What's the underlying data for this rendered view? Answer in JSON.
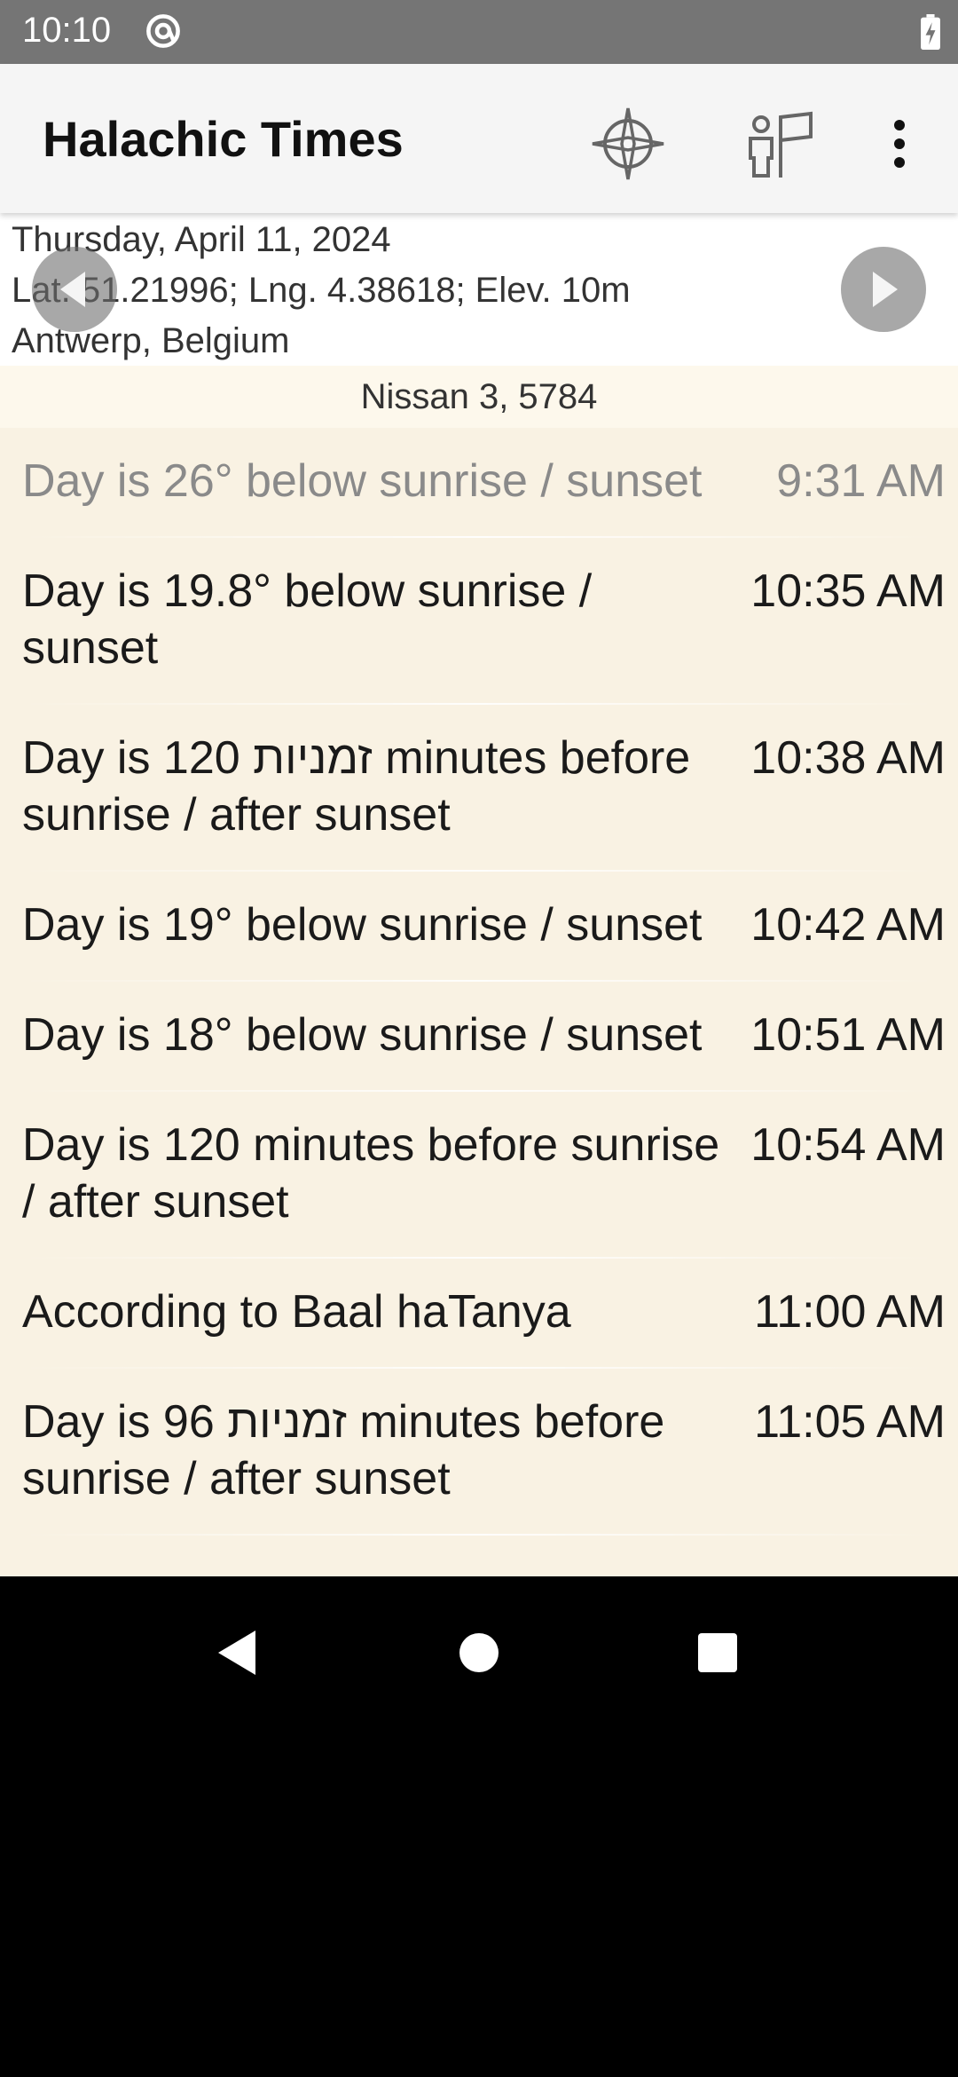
{
  "status": {
    "time": "10:10"
  },
  "appbar": {
    "title": "Halachic Times"
  },
  "header": {
    "date": "Thursday, April 11, 2024",
    "coordinates": "Lat. 51.21996; Lng. 4.38618; Elev. 10m",
    "location": "Antwerp, Belgium",
    "hebrew_date": "Nissan 3, 5784"
  },
  "times": [
    {
      "label": "Day is 26° below sunrise / sunset",
      "time": "9:31 AM"
    },
    {
      "label": "Day is 19.8° below sunrise / sunset",
      "time": "10:35 AM"
    },
    {
      "label": "Day is 120 זמניות minutes before sunrise / after sunset",
      "time": "10:38 AM"
    },
    {
      "label": "Day is 19° below sunrise / sunset",
      "time": "10:42 AM"
    },
    {
      "label": "Day is 18° below sunrise / sunset",
      "time": "10:51 AM"
    },
    {
      "label": "Day is 120 minutes before sunrise / after sunset",
      "time": "10:54 AM"
    },
    {
      "label": "According to Baal haTanya",
      "time": "11:00 AM"
    },
    {
      "label": "Day is 96 זמניות minutes before sunrise / after sunset",
      "time": "11:05 AM"
    }
  ],
  "icons": {
    "status": [
      "at-sign-icon",
      "battery-charging-icon"
    ],
    "appbar": [
      "compass-icon",
      "person-sign-icon",
      "more-vert-icon"
    ],
    "navigation": [
      "previous-day-icon",
      "next-day-icon"
    ],
    "system": [
      "back-icon",
      "home-icon",
      "recents-icon"
    ]
  }
}
